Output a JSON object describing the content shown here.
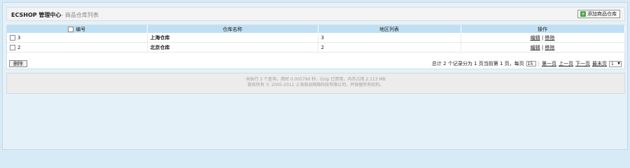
{
  "header": {
    "title": "ECSHOP 管理中心",
    "subtitle": "- 商品仓库列表",
    "add_button": "添加商品仓库"
  },
  "table": {
    "columns": [
      "编号",
      "仓库名称",
      "地区列表",
      "操作"
    ],
    "rows": [
      {
        "id": "3",
        "name": "上海仓库",
        "region": "3",
        "edit": "编辑",
        "sep": "|",
        "remove": "移除"
      },
      {
        "id": "2",
        "name": "北京仓库",
        "region": "2",
        "edit": "编辑",
        "sep": "|",
        "remove": "移除"
      }
    ]
  },
  "footer": {
    "delete_button": "删除",
    "summary": "总计 2 个记录分为 1 页当前第 1 页，每页",
    "per_page": "15",
    "first": "第一页",
    "prev": "上一页",
    "next": "下一页",
    "last": "最末页",
    "page_select": "1"
  },
  "status": {
    "line1": "共执行 3 个查询，用时 0.005790 秒，Gzip 已禁用，内存占用 2.113 MB",
    "line2": "版权所有 © 2005-2012 上海商派网络科技有限公司，并保留所有权利。"
  }
}
